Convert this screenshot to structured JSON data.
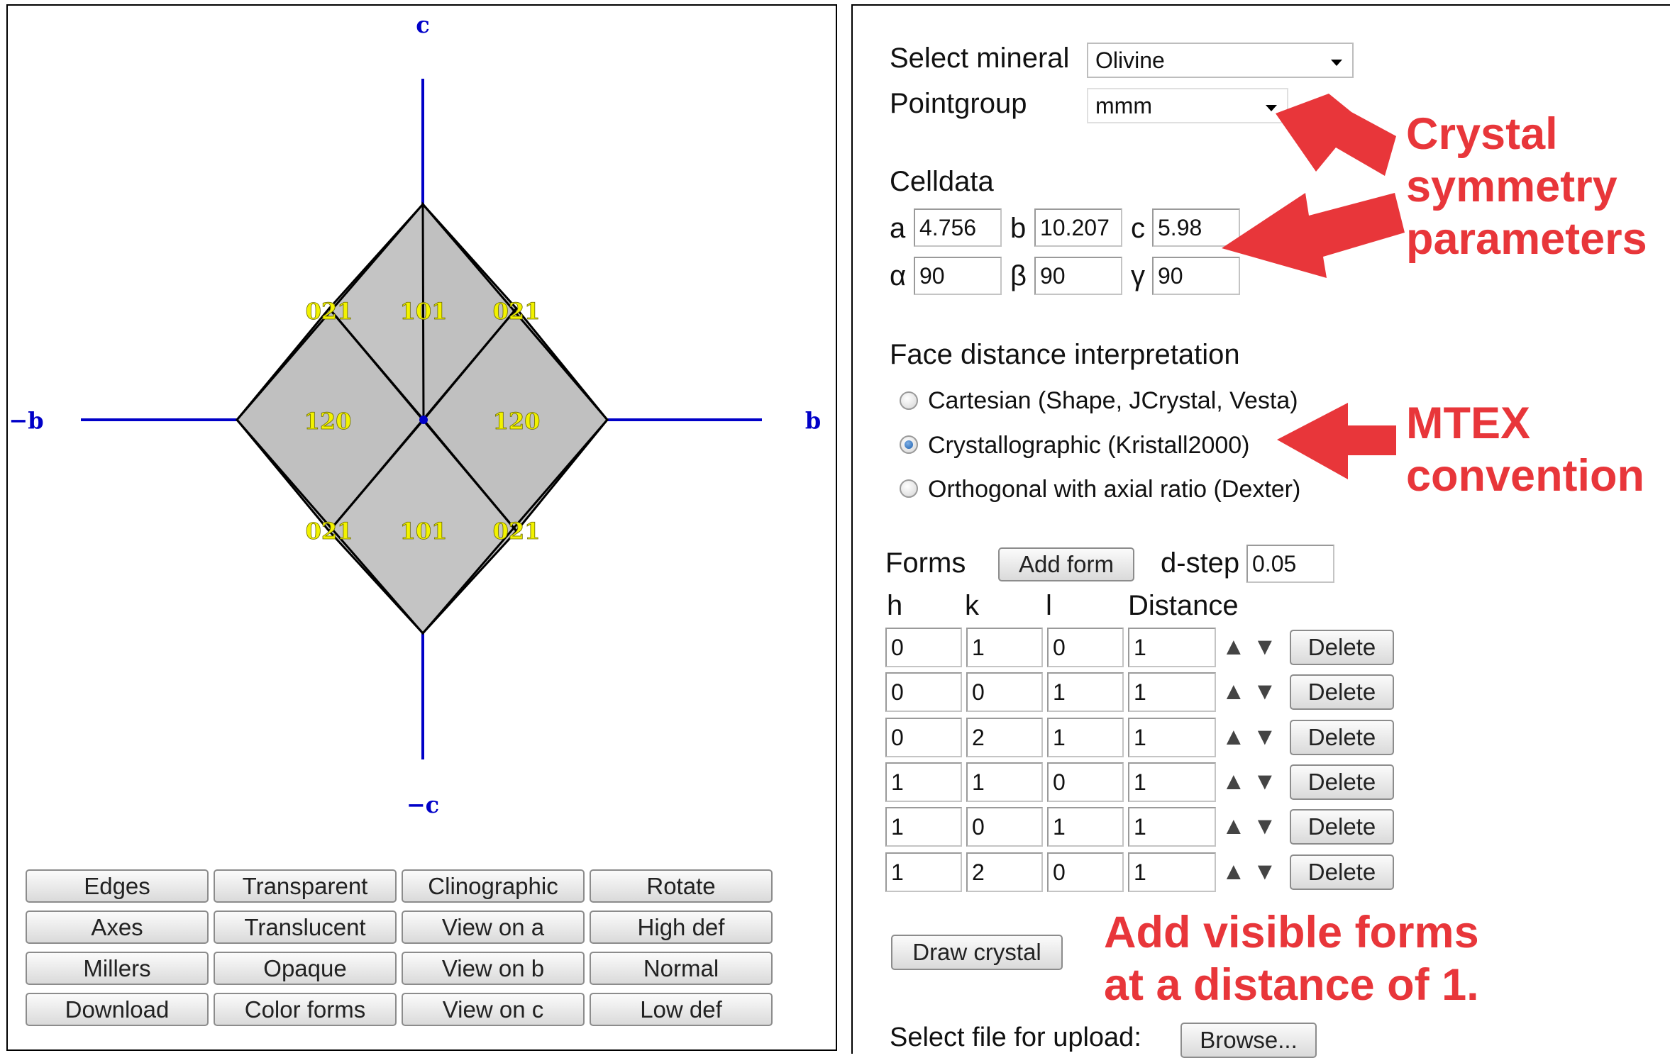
{
  "viewer": {
    "axis_labels": {
      "c": "c",
      "neg_c": "−c",
      "b": "b",
      "neg_b": "−b"
    },
    "face_labels": {
      "top_left_021": "021",
      "top_101": "101",
      "top_right_021": "021",
      "left_120": "120",
      "right_120": "120",
      "bottom_left_021": "021",
      "bottom_101": "101",
      "bottom_right_021": "021"
    },
    "colors": {
      "axis": "#0000c8",
      "face_fill": "#c4c4c4",
      "face_label": "#f2f200"
    }
  },
  "view_buttons": [
    [
      "Edges",
      "Transparent",
      "Clinographic",
      "Rotate"
    ],
    [
      "Axes",
      "Translucent",
      "View on a",
      "High def"
    ],
    [
      "Millers",
      "Opaque",
      "View on b",
      "Normal"
    ],
    [
      "Download",
      "Color forms",
      "View on c",
      "Low def"
    ]
  ],
  "settings": {
    "mineral_label": "Select mineral",
    "mineral_value": "Olivine",
    "pointgroup_label": "Pointgroup",
    "pointgroup_value": "mmm",
    "celldata_label": "Celldata",
    "cell": {
      "a_label": "a",
      "a": "4.756",
      "b_label": "b",
      "b": "10.207",
      "c_label": "c",
      "c": "5.98",
      "alpha_label": "α",
      "alpha": "90",
      "beta_label": "β",
      "beta": "90",
      "gamma_label": "γ",
      "gamma": "90"
    },
    "face_distance_label": "Face distance interpretation",
    "face_distance_options": [
      {
        "label": "Cartesian (Shape, JCrystal, Vesta)",
        "checked": false
      },
      {
        "label": "Crystallographic (Kristall2000)",
        "checked": true
      },
      {
        "label": "Orthogonal with axial ratio (Dexter)",
        "checked": false
      }
    ],
    "forms_label": "Forms",
    "add_form_label": "Add form",
    "dstep_label": "d-step",
    "dstep_value": "0.05",
    "headers": {
      "h": "h",
      "k": "k",
      "l": "l",
      "distance": "Distance"
    },
    "forms": [
      {
        "h": "0",
        "k": "1",
        "l": "0",
        "d": "1"
      },
      {
        "h": "0",
        "k": "0",
        "l": "1",
        "d": "1"
      },
      {
        "h": "0",
        "k": "2",
        "l": "1",
        "d": "1"
      },
      {
        "h": "1",
        "k": "1",
        "l": "0",
        "d": "1"
      },
      {
        "h": "1",
        "k": "0",
        "l": "1",
        "d": "1"
      },
      {
        "h": "1",
        "k": "2",
        "l": "0",
        "d": "1"
      }
    ],
    "delete_label": "Delete",
    "up_glyph": "▲",
    "down_glyph": "▼",
    "draw_label": "Draw crystal",
    "upload_label": "Select file for upload:",
    "browse_label": "Browse..."
  },
  "annotations": {
    "crystal": [
      "Crystal",
      "symmetry",
      "parameters"
    ],
    "mtex": [
      "MTEX",
      "convention"
    ],
    "forms": [
      "Add visible forms",
      "at a distance of 1."
    ],
    "color": "#e8363a"
  }
}
